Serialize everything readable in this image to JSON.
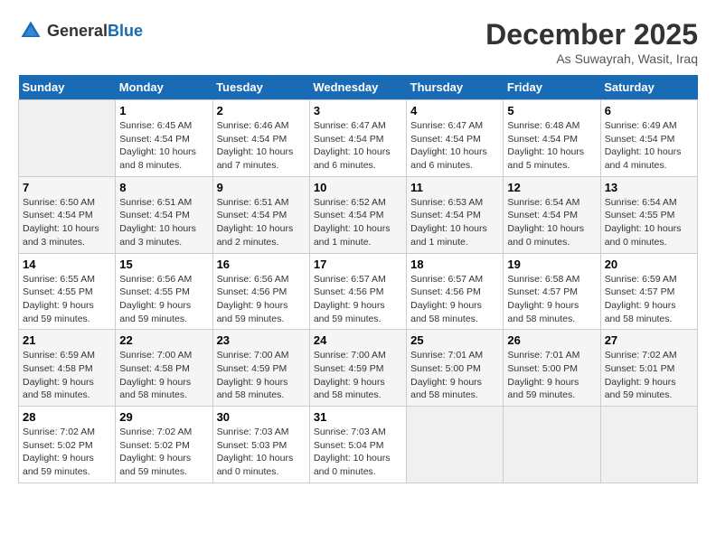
{
  "header": {
    "logo_general": "General",
    "logo_blue": "Blue",
    "month_year": "December 2025",
    "location": "As Suwayrah, Wasit, Iraq"
  },
  "weekdays": [
    "Sunday",
    "Monday",
    "Tuesday",
    "Wednesday",
    "Thursday",
    "Friday",
    "Saturday"
  ],
  "weeks": [
    [
      {
        "day": "",
        "sunrise": "",
        "sunset": "",
        "daylight": ""
      },
      {
        "day": "1",
        "sunrise": "Sunrise: 6:45 AM",
        "sunset": "Sunset: 4:54 PM",
        "daylight": "Daylight: 10 hours and 8 minutes."
      },
      {
        "day": "2",
        "sunrise": "Sunrise: 6:46 AM",
        "sunset": "Sunset: 4:54 PM",
        "daylight": "Daylight: 10 hours and 7 minutes."
      },
      {
        "day": "3",
        "sunrise": "Sunrise: 6:47 AM",
        "sunset": "Sunset: 4:54 PM",
        "daylight": "Daylight: 10 hours and 6 minutes."
      },
      {
        "day": "4",
        "sunrise": "Sunrise: 6:47 AM",
        "sunset": "Sunset: 4:54 PM",
        "daylight": "Daylight: 10 hours and 6 minutes."
      },
      {
        "day": "5",
        "sunrise": "Sunrise: 6:48 AM",
        "sunset": "Sunset: 4:54 PM",
        "daylight": "Daylight: 10 hours and 5 minutes."
      },
      {
        "day": "6",
        "sunrise": "Sunrise: 6:49 AM",
        "sunset": "Sunset: 4:54 PM",
        "daylight": "Daylight: 10 hours and 4 minutes."
      }
    ],
    [
      {
        "day": "7",
        "sunrise": "Sunrise: 6:50 AM",
        "sunset": "Sunset: 4:54 PM",
        "daylight": "Daylight: 10 hours and 3 minutes."
      },
      {
        "day": "8",
        "sunrise": "Sunrise: 6:51 AM",
        "sunset": "Sunset: 4:54 PM",
        "daylight": "Daylight: 10 hours and 3 minutes."
      },
      {
        "day": "9",
        "sunrise": "Sunrise: 6:51 AM",
        "sunset": "Sunset: 4:54 PM",
        "daylight": "Daylight: 10 hours and 2 minutes."
      },
      {
        "day": "10",
        "sunrise": "Sunrise: 6:52 AM",
        "sunset": "Sunset: 4:54 PM",
        "daylight": "Daylight: 10 hours and 1 minute."
      },
      {
        "day": "11",
        "sunrise": "Sunrise: 6:53 AM",
        "sunset": "Sunset: 4:54 PM",
        "daylight": "Daylight: 10 hours and 1 minute."
      },
      {
        "day": "12",
        "sunrise": "Sunrise: 6:54 AM",
        "sunset": "Sunset: 4:54 PM",
        "daylight": "Daylight: 10 hours and 0 minutes."
      },
      {
        "day": "13",
        "sunrise": "Sunrise: 6:54 AM",
        "sunset": "Sunset: 4:55 PM",
        "daylight": "Daylight: 10 hours and 0 minutes."
      }
    ],
    [
      {
        "day": "14",
        "sunrise": "Sunrise: 6:55 AM",
        "sunset": "Sunset: 4:55 PM",
        "daylight": "Daylight: 9 hours and 59 minutes."
      },
      {
        "day": "15",
        "sunrise": "Sunrise: 6:56 AM",
        "sunset": "Sunset: 4:55 PM",
        "daylight": "Daylight: 9 hours and 59 minutes."
      },
      {
        "day": "16",
        "sunrise": "Sunrise: 6:56 AM",
        "sunset": "Sunset: 4:56 PM",
        "daylight": "Daylight: 9 hours and 59 minutes."
      },
      {
        "day": "17",
        "sunrise": "Sunrise: 6:57 AM",
        "sunset": "Sunset: 4:56 PM",
        "daylight": "Daylight: 9 hours and 59 minutes."
      },
      {
        "day": "18",
        "sunrise": "Sunrise: 6:57 AM",
        "sunset": "Sunset: 4:56 PM",
        "daylight": "Daylight: 9 hours and 58 minutes."
      },
      {
        "day": "19",
        "sunrise": "Sunrise: 6:58 AM",
        "sunset": "Sunset: 4:57 PM",
        "daylight": "Daylight: 9 hours and 58 minutes."
      },
      {
        "day": "20",
        "sunrise": "Sunrise: 6:59 AM",
        "sunset": "Sunset: 4:57 PM",
        "daylight": "Daylight: 9 hours and 58 minutes."
      }
    ],
    [
      {
        "day": "21",
        "sunrise": "Sunrise: 6:59 AM",
        "sunset": "Sunset: 4:58 PM",
        "daylight": "Daylight: 9 hours and 58 minutes."
      },
      {
        "day": "22",
        "sunrise": "Sunrise: 7:00 AM",
        "sunset": "Sunset: 4:58 PM",
        "daylight": "Daylight: 9 hours and 58 minutes."
      },
      {
        "day": "23",
        "sunrise": "Sunrise: 7:00 AM",
        "sunset": "Sunset: 4:59 PM",
        "daylight": "Daylight: 9 hours and 58 minutes."
      },
      {
        "day": "24",
        "sunrise": "Sunrise: 7:00 AM",
        "sunset": "Sunset: 4:59 PM",
        "daylight": "Daylight: 9 hours and 58 minutes."
      },
      {
        "day": "25",
        "sunrise": "Sunrise: 7:01 AM",
        "sunset": "Sunset: 5:00 PM",
        "daylight": "Daylight: 9 hours and 58 minutes."
      },
      {
        "day": "26",
        "sunrise": "Sunrise: 7:01 AM",
        "sunset": "Sunset: 5:00 PM",
        "daylight": "Daylight: 9 hours and 59 minutes."
      },
      {
        "day": "27",
        "sunrise": "Sunrise: 7:02 AM",
        "sunset": "Sunset: 5:01 PM",
        "daylight": "Daylight: 9 hours and 59 minutes."
      }
    ],
    [
      {
        "day": "28",
        "sunrise": "Sunrise: 7:02 AM",
        "sunset": "Sunset: 5:02 PM",
        "daylight": "Daylight: 9 hours and 59 minutes."
      },
      {
        "day": "29",
        "sunrise": "Sunrise: 7:02 AM",
        "sunset": "Sunset: 5:02 PM",
        "daylight": "Daylight: 9 hours and 59 minutes."
      },
      {
        "day": "30",
        "sunrise": "Sunrise: 7:03 AM",
        "sunset": "Sunset: 5:03 PM",
        "daylight": "Daylight: 10 hours and 0 minutes."
      },
      {
        "day": "31",
        "sunrise": "Sunrise: 7:03 AM",
        "sunset": "Sunset: 5:04 PM",
        "daylight": "Daylight: 10 hours and 0 minutes."
      },
      {
        "day": "",
        "sunrise": "",
        "sunset": "",
        "daylight": ""
      },
      {
        "day": "",
        "sunrise": "",
        "sunset": "",
        "daylight": ""
      },
      {
        "day": "",
        "sunrise": "",
        "sunset": "",
        "daylight": ""
      }
    ]
  ]
}
